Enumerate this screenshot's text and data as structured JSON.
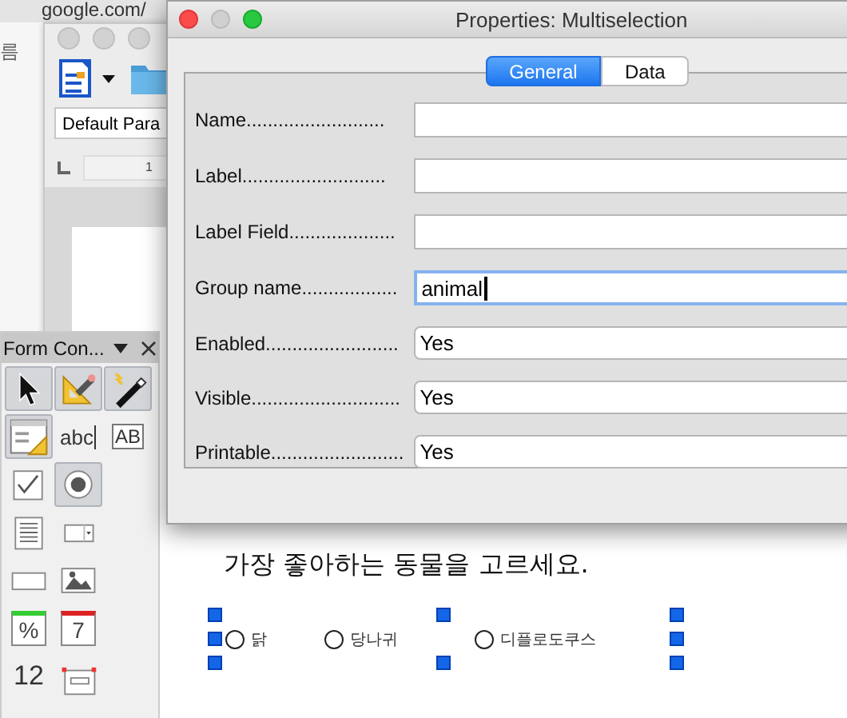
{
  "browser": {
    "address": "google.com/",
    "side_text": "름"
  },
  "writer_window": {
    "paragraph_style": "Default Para",
    "ruler_mark": "1"
  },
  "document": {
    "question": "가장 좋아하는 동물을 고르세요.",
    "options": [
      {
        "label": "닭",
        "selected": false
      },
      {
        "label": "당나귀",
        "selected": false
      },
      {
        "label": "디플로도쿠스",
        "selected": false
      }
    ]
  },
  "form_controls": {
    "title": "Form Con...",
    "tools": [
      {
        "kind": "pointer",
        "on": true
      },
      {
        "kind": "design",
        "on": true
      },
      {
        "kind": "wizard",
        "on": true
      },
      {
        "kind": "listbox-design",
        "on": true
      },
      {
        "kind": "label",
        "on": false,
        "glyph": "abc"
      },
      {
        "kind": "textbox",
        "on": false,
        "glyph": "AB"
      },
      {
        "kind": "checkbox",
        "on": false
      },
      {
        "kind": "radio",
        "on": true
      },
      {
        "kind": "list",
        "on": false
      },
      {
        "kind": "combo",
        "on": false
      },
      {
        "kind": "pushbutton",
        "on": false
      },
      {
        "kind": "image",
        "on": false
      },
      {
        "kind": "formatted",
        "on": false,
        "glyph": "%"
      },
      {
        "kind": "date",
        "on": false,
        "glyph": "7"
      },
      {
        "kind": "numeric",
        "on": false,
        "glyph": "12"
      },
      {
        "kind": "groupbox",
        "on": false
      }
    ]
  },
  "dialog": {
    "title": "Properties: Multiselection",
    "tabs": [
      {
        "label": "General",
        "selected": true
      },
      {
        "label": "Data",
        "selected": false
      }
    ],
    "fields": [
      {
        "label": "Name..........................",
        "kind": "text"
      },
      {
        "label": "Label...........................",
        "kind": "text"
      },
      {
        "label": "Label Field....................",
        "kind": "text"
      },
      {
        "label": "Group name..................",
        "kind": "text",
        "value": "animal",
        "focused": true
      },
      {
        "label": "Enabled.........................",
        "kind": "list",
        "value": "Yes"
      },
      {
        "label": "Visible............................",
        "kind": "list",
        "value": "Yes"
      },
      {
        "label": "Printable.........................",
        "kind": "list",
        "value": "Yes"
      }
    ]
  }
}
